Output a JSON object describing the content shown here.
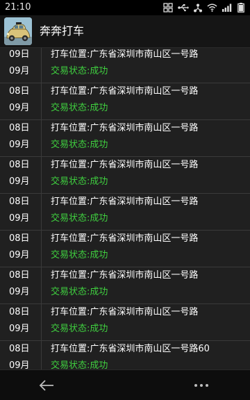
{
  "status_bar": {
    "time": "21:10",
    "icons": [
      "screen-capture-icon",
      "usb-icon",
      "share-icon",
      "wifi-icon",
      "signal-icon",
      "battery-icon"
    ]
  },
  "app_bar": {
    "icon": "taxi-car-icon",
    "title": "奔奔打车"
  },
  "records": [
    {
      "day": "09日",
      "month": "09月",
      "location": "打车位置:广东省深圳市南山区一号路",
      "status": "交易状态:成功"
    },
    {
      "day": "08日",
      "month": "09月",
      "location": "打车位置:广东省深圳市南山区一号路",
      "status": "交易状态:成功"
    },
    {
      "day": "08日",
      "month": "09月",
      "location": "打车位置:广东省深圳市南山区一号路",
      "status": "交易状态:成功"
    },
    {
      "day": "08日",
      "month": "09月",
      "location": "打车位置:广东省深圳市南山区一号路",
      "status": "交易状态:成功"
    },
    {
      "day": "08日",
      "month": "09月",
      "location": "打车位置:广东省深圳市南山区一号路",
      "status": "交易状态:成功"
    },
    {
      "day": "08日",
      "month": "09月",
      "location": "打车位置:广东省深圳市南山区一号路",
      "status": "交易状态:成功"
    },
    {
      "day": "08日",
      "month": "09月",
      "location": "打车位置:广东省深圳市南山区一号路",
      "status": "交易状态:成功"
    },
    {
      "day": "08日",
      "month": "09月",
      "location": "打车位置:广东省深圳市南山区一号路",
      "status": "交易状态:成功"
    },
    {
      "day": "08日",
      "month": "09月",
      "location": "打车位置:广东省深圳市南山区一号路60",
      "status": "交易状态:成功"
    }
  ],
  "nav_bar": {
    "back_icon": "back-arrow-icon",
    "more_icon": "more-dots-icon"
  },
  "colors": {
    "success_green": "#3fcf3f",
    "background": "#1b1b1b",
    "divider": "#3a3a3a"
  }
}
